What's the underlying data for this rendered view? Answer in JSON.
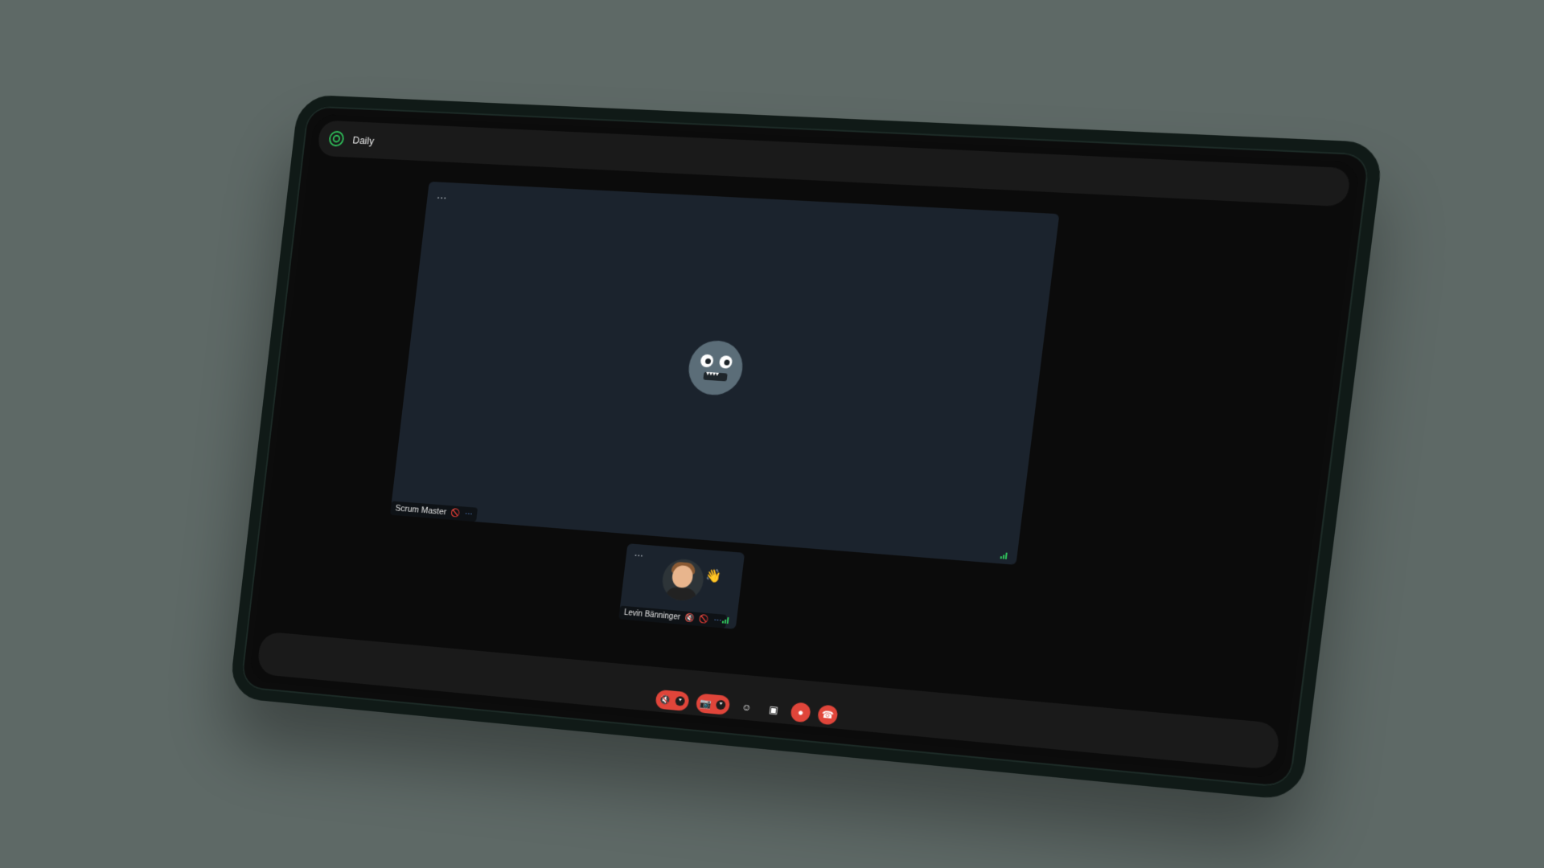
{
  "app": {
    "title": "Daily"
  },
  "main_tile": {
    "menu": "…",
    "participant": {
      "name": "Scrum Master",
      "mic": "mic-muted-icon",
      "cam": "camera-off-icon"
    }
  },
  "thumbnail": {
    "menu": "…",
    "participant": {
      "name": "Levin Bänninger",
      "mic": "mic-muted-icon",
      "cam": "camera-off-icon"
    }
  },
  "controls": [
    {
      "name": "toggle-mic",
      "icon": "mic-muted-icon",
      "state": "off"
    },
    {
      "name": "toggle-camera",
      "icon": "camera-off-icon",
      "state": "off"
    },
    {
      "name": "reactions",
      "icon": "emoji-icon"
    },
    {
      "name": "share-screen",
      "icon": "screen-share-icon"
    },
    {
      "name": "record",
      "icon": "record-icon",
      "state": "on"
    },
    {
      "name": "leave-call",
      "icon": "hangup-icon"
    }
  ],
  "colors": {
    "accent_green": "#2fbf5a",
    "danger_red": "#e0453a",
    "tile_bg": "#1b232d"
  }
}
